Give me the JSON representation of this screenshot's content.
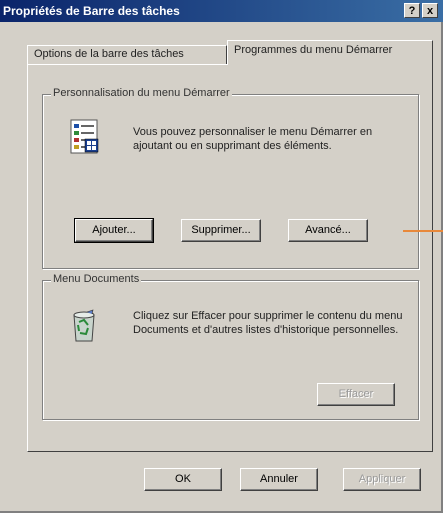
{
  "window": {
    "title": "Propriétés de Barre des tâches",
    "help_glyph": "?",
    "close_glyph": "x"
  },
  "tabs": [
    {
      "label": "Options de la barre des tâches",
      "active": false
    },
    {
      "label": "Programmes du menu Démarrer",
      "active": true
    }
  ],
  "group_start": {
    "label": "Personnalisation du menu Démarrer",
    "description": "Vous pouvez personnaliser le menu Démarrer en ajoutant ou en supprimant des éléments.",
    "buttons": {
      "add": "Ajouter...",
      "remove": "Supprimer...",
      "advanced": "Avancé..."
    }
  },
  "group_documents": {
    "label": "Menu Documents",
    "description": "Cliquez sur Effacer pour supprimer le contenu du menu Documents et d'autres listes d'historique personnelles.",
    "clear_button": "Effacer"
  },
  "footer": {
    "ok": "OK",
    "cancel": "Annuler",
    "apply": "Appliquer"
  },
  "colors": {
    "titlebar_start": "#0a246a",
    "titlebar_end": "#3a6ea5",
    "face": "#d4d0c8",
    "annotation_arrow": "#e8883a"
  }
}
